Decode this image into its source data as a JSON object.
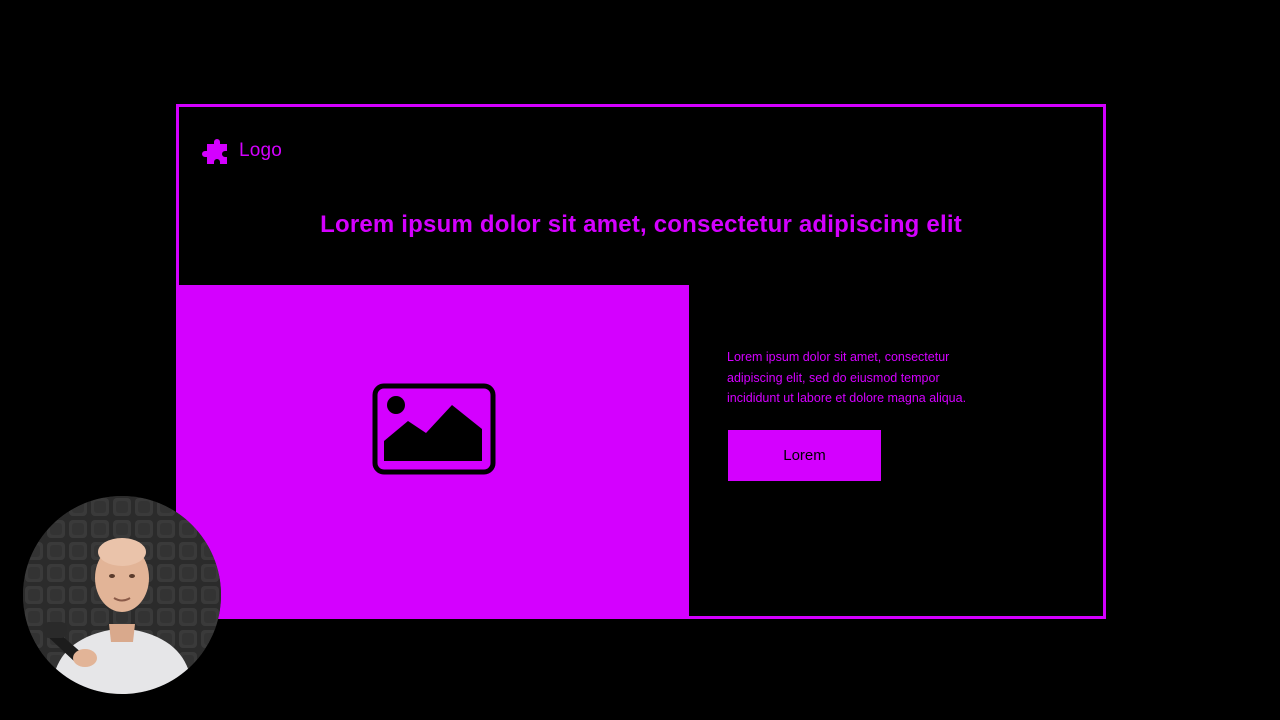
{
  "slide": {
    "logo_text": "Logo",
    "logo_icon": "puzzle-piece-icon",
    "headline": "Lorem ipsum dolor sit amet, consectetur adipiscing elit",
    "image_icon": "image-placeholder-icon",
    "body_lines": [
      "Lorem ipsum dolor sit amet, consectetur",
      "adipiscing elit, sed do eiusmod tempor",
      "incididunt ut labore et dolore magna aliqua."
    ],
    "button_label": "Lorem"
  },
  "colors": {
    "accent": "#d400ff",
    "background": "#000000"
  }
}
